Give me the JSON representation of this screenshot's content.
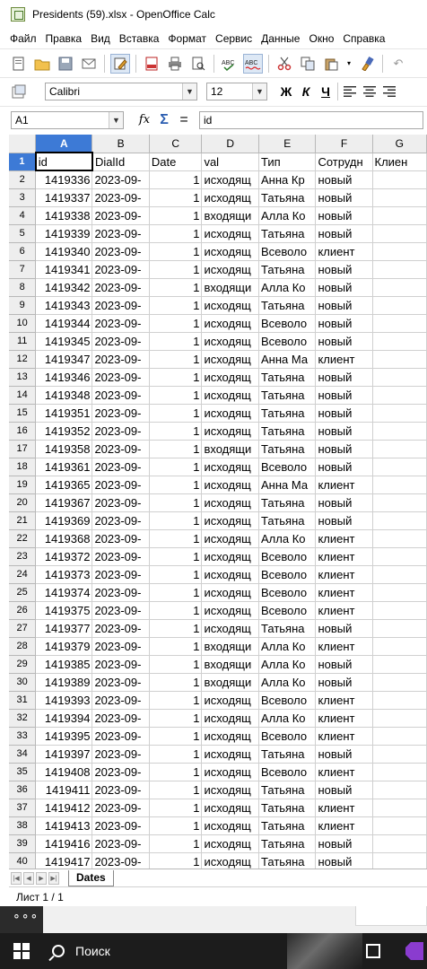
{
  "window": {
    "title": "Presidents (59).xlsx - OpenOffice Calc"
  },
  "menu": [
    "Файл",
    "Правка",
    "Вид",
    "Вставка",
    "Формат",
    "Сервис",
    "Данные",
    "Окно",
    "Справка"
  ],
  "toolbar": {
    "icons": [
      "new-document-icon",
      "open-folder-icon",
      "save-icon",
      "email-icon",
      "edit-mode-icon",
      "export-pdf-icon",
      "print-icon",
      "page-preview-icon",
      "spellcheck-icon",
      "autospellcheck-icon",
      "cut-icon",
      "copy-icon",
      "paste-icon",
      "format-paintbrush-icon",
      "undo-icon"
    ]
  },
  "format": {
    "font_name": "Calibri",
    "font_size": "12",
    "bold": "Ж",
    "italic": "К",
    "underline": "Ч"
  },
  "formula": {
    "cell_ref": "A1",
    "function_wizard": "fx",
    "sum": "Σ",
    "equals": "=",
    "value": "id"
  },
  "grid": {
    "column_headers": [
      "A",
      "B",
      "C",
      "D",
      "E",
      "F",
      "G"
    ],
    "header_row": [
      "id",
      "DialId",
      "Date",
      "val",
      "Тип",
      "Сотрудн",
      "Клиен"
    ],
    "rows": [
      [
        "1419336",
        "2023-09-",
        "1",
        "исходящ",
        "Анна Кр",
        "новый"
      ],
      [
        "1419337",
        "2023-09-",
        "1",
        "исходящ",
        "Татьяна",
        "новый"
      ],
      [
        "1419338",
        "2023-09-",
        "1",
        "входящи",
        "Алла Ко",
        "новый"
      ],
      [
        "1419339",
        "2023-09-",
        "1",
        "исходящ",
        "Татьяна",
        "новый"
      ],
      [
        "1419340",
        "2023-09-",
        "1",
        "исходящ",
        "Всеволо",
        "клиент"
      ],
      [
        "1419341",
        "2023-09-",
        "1",
        "исходящ",
        "Татьяна",
        "новый"
      ],
      [
        "1419342",
        "2023-09-",
        "1",
        "входящи",
        "Алла Ко",
        "новый"
      ],
      [
        "1419343",
        "2023-09-",
        "1",
        "исходящ",
        "Татьяна",
        "новый"
      ],
      [
        "1419344",
        "2023-09-",
        "1",
        "исходящ",
        "Всеволо",
        "новый"
      ],
      [
        "1419345",
        "2023-09-",
        "1",
        "исходящ",
        "Всеволо",
        "новый"
      ],
      [
        "1419347",
        "2023-09-",
        "1",
        "исходящ",
        "Анна Ма",
        "клиент"
      ],
      [
        "1419346",
        "2023-09-",
        "1",
        "исходящ",
        "Татьяна",
        "новый"
      ],
      [
        "1419348",
        "2023-09-",
        "1",
        "исходящ",
        "Татьяна",
        "новый"
      ],
      [
        "1419351",
        "2023-09-",
        "1",
        "исходящ",
        "Татьяна",
        "новый"
      ],
      [
        "1419352",
        "2023-09-",
        "1",
        "исходящ",
        "Татьяна",
        "новый"
      ],
      [
        "1419358",
        "2023-09-",
        "1",
        "входящи",
        "Татьяна",
        "новый"
      ],
      [
        "1419361",
        "2023-09-",
        "1",
        "исходящ",
        "Всеволо",
        "новый"
      ],
      [
        "1419365",
        "2023-09-",
        "1",
        "исходящ",
        "Анна Ма",
        "клиент"
      ],
      [
        "1419367",
        "2023-09-",
        "1",
        "исходящ",
        "Татьяна",
        "новый"
      ],
      [
        "1419369",
        "2023-09-",
        "1",
        "исходящ",
        "Татьяна",
        "новый"
      ],
      [
        "1419368",
        "2023-09-",
        "1",
        "исходящ",
        "Алла Ко",
        "клиент"
      ],
      [
        "1419372",
        "2023-09-",
        "1",
        "исходящ",
        "Всеволо",
        "клиент"
      ],
      [
        "1419373",
        "2023-09-",
        "1",
        "исходящ",
        "Всеволо",
        "клиент"
      ],
      [
        "1419374",
        "2023-09-",
        "1",
        "исходящ",
        "Всеволо",
        "клиент"
      ],
      [
        "1419375",
        "2023-09-",
        "1",
        "исходящ",
        "Всеволо",
        "клиент"
      ],
      [
        "1419377",
        "2023-09-",
        "1",
        "исходящ",
        "Татьяна",
        "новый"
      ],
      [
        "1419379",
        "2023-09-",
        "1",
        "входящи",
        "Алла Ко",
        "клиент"
      ],
      [
        "1419385",
        "2023-09-",
        "1",
        "входящи",
        "Алла Ко",
        "новый"
      ],
      [
        "1419389",
        "2023-09-",
        "1",
        "входящи",
        "Алла Ко",
        "новый"
      ],
      [
        "1419393",
        "2023-09-",
        "1",
        "исходящ",
        "Всеволо",
        "клиент"
      ],
      [
        "1419394",
        "2023-09-",
        "1",
        "исходящ",
        "Алла Ко",
        "клиент"
      ],
      [
        "1419395",
        "2023-09-",
        "1",
        "исходящ",
        "Всеволо",
        "клиент"
      ],
      [
        "1419397",
        "2023-09-",
        "1",
        "исходящ",
        "Татьяна",
        "новый"
      ],
      [
        "1419408",
        "2023-09-",
        "1",
        "исходящ",
        "Всеволо",
        "клиент"
      ],
      [
        "1419411",
        "2023-09-",
        "1",
        "исходящ",
        "Татьяна",
        "новый"
      ],
      [
        "1419412",
        "2023-09-",
        "1",
        "исходящ",
        "Татьяна",
        "клиент"
      ],
      [
        "1419413",
        "2023-09-",
        "1",
        "исходящ",
        "Татьяна",
        "клиент"
      ],
      [
        "1419416",
        "2023-09-",
        "1",
        "исходящ",
        "Татьяна",
        "новый"
      ],
      [
        "1419417",
        "2023-09-",
        "1",
        "исходящ",
        "Татьяна",
        "новый"
      ]
    ]
  },
  "sheet_tabs": [
    "Dates"
  ],
  "status": {
    "sheet": "Лист 1 / 1"
  },
  "taskbar": {
    "search_label": "Поиск"
  },
  "colors": {
    "selected_header": "#3d7ad6",
    "taskbar": "#1c1c1c",
    "header_bg": "#eeeeee"
  }
}
